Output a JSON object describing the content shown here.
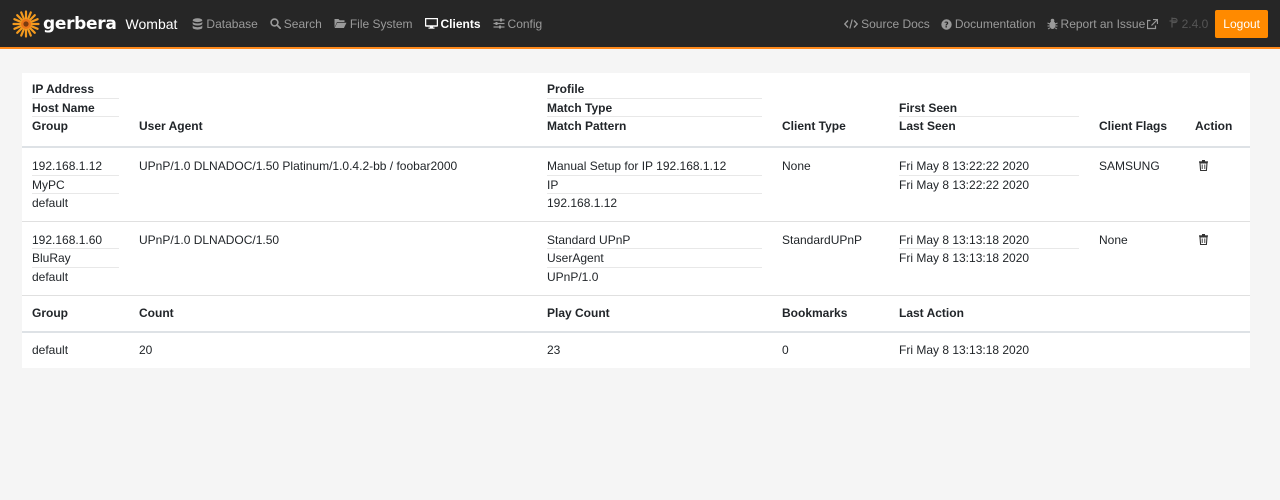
{
  "navbar": {
    "brand_name": "gerbera",
    "brand_ui": "Wombat",
    "items": [
      {
        "label": "Database",
        "icon": "database-icon",
        "active": false
      },
      {
        "label": "Search",
        "icon": "search-icon",
        "active": false
      },
      {
        "label": "File System",
        "icon": "folder-open-icon",
        "active": false
      },
      {
        "label": "Clients",
        "icon": "desktop-icon",
        "active": true
      },
      {
        "label": "Config",
        "icon": "sliders-icon",
        "active": false
      }
    ],
    "right": {
      "source_docs": "Source Docs",
      "documentation": "Documentation",
      "report_issue": "Report an Issue",
      "version": "2.4.0",
      "logout": "Logout"
    },
    "accent_color": "#ff8a00"
  },
  "clients_table": {
    "headers": {
      "ip_address": "IP Address",
      "host_name": "Host Name",
      "group": "Group",
      "user_agent": "User Agent",
      "profile": "Profile",
      "match_type": "Match Type",
      "match_pattern": "Match Pattern",
      "client_type": "Client Type",
      "first_seen": "First Seen",
      "last_seen": "Last Seen",
      "client_flags": "Client Flags",
      "action": "Action"
    },
    "rows": [
      {
        "ip": "192.168.1.12",
        "host": "MyPC",
        "group": "default",
        "user_agent": "UPnP/1.0 DLNADOC/1.50 Platinum/1.0.4.2-bb / foobar2000",
        "profile": "Manual Setup for IP 192.168.1.12",
        "match_type": "IP",
        "match_pattern": "192.168.1.12",
        "client_type": "None",
        "first_seen": "Fri May 8 13:22:22 2020",
        "last_seen": "Fri May 8 13:22:22 2020",
        "client_flags": "SAMSUNG"
      },
      {
        "ip": "192.168.1.60",
        "host": "BluRay",
        "group": "default",
        "user_agent": "UPnP/1.0 DLNADOC/1.50",
        "profile": "Standard UPnP",
        "match_type": "UserAgent",
        "match_pattern": "UPnP/1.0",
        "client_type": "StandardUPnP",
        "first_seen": "Fri May 8 13:13:18 2020",
        "last_seen": "Fri May 8 13:13:18 2020",
        "client_flags": "None"
      }
    ]
  },
  "stats_table": {
    "headers": {
      "group": "Group",
      "count": "Count",
      "play_count": "Play Count",
      "bookmarks": "Bookmarks",
      "last_action": "Last Action"
    },
    "rows": [
      {
        "group": "default",
        "count": "20",
        "play_count": "23",
        "bookmarks": "0",
        "last_action": "Fri May 8 13:13:18 2020"
      }
    ]
  }
}
